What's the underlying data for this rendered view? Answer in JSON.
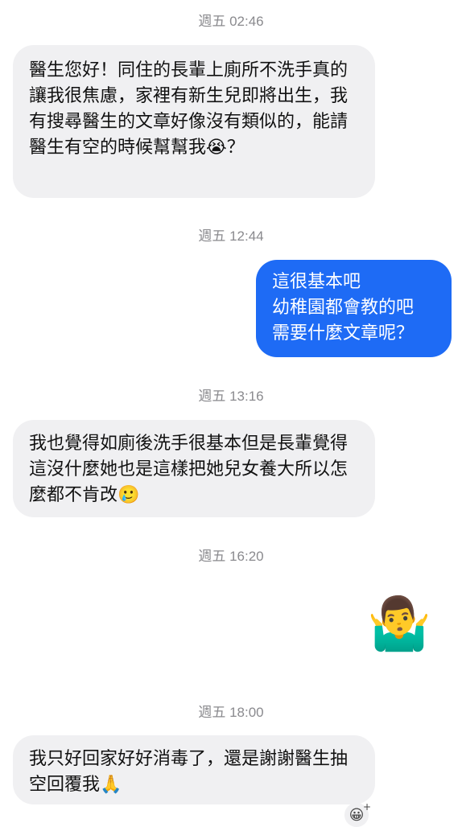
{
  "timestamps": [
    "週五 02:46",
    "週五 12:44",
    "週五 13:16",
    "週五 16:20",
    "週五 18:00"
  ],
  "messages": {
    "m1": {
      "text": "醫生您好！同住的長輩上廁所不洗手真的讓我很焦慮，家裡有新生兒即將出生，我有搜尋醫生的文章好像沒有類似的，能請醫生有空的時候幫幫我",
      "tail_emoji": "😭",
      "tail_text": "？"
    },
    "m2": {
      "lines": [
        "這很基本吧",
        "幼稚園都會教的吧",
        "需要什麼文章呢？"
      ]
    },
    "m3": {
      "text": "我也覺得如廁後洗手很基本但是長輩覺得這沒什麼她也是這樣把她兒女養大所以怎麼都不肯改",
      "tail_emoji": "🥲"
    },
    "m4": {
      "emoji": "🤷‍♂️"
    },
    "m5": {
      "text": "我只好回家好好消毒了，還是謝謝醫生抽空回覆我",
      "tail_emoji": "🙏"
    }
  },
  "reaction_button": {
    "icon": "😀",
    "plus": "+"
  }
}
